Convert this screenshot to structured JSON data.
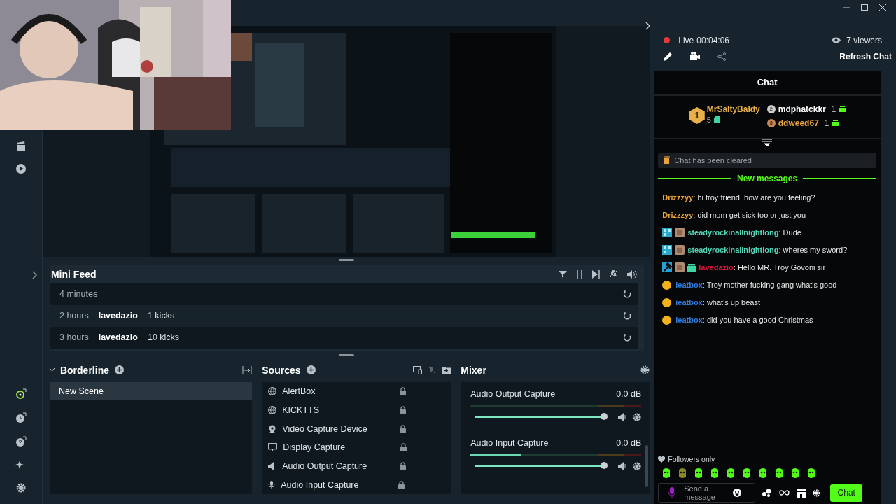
{
  "stream": {
    "live": true,
    "live_label": "Live",
    "timer": "00:04:06",
    "viewers": "7 viewers",
    "refresh": "Refresh Chat"
  },
  "mini_feed": {
    "title": "Mini Feed",
    "rows": [
      {
        "time": "4 minutes"
      },
      {
        "time": "2 hours",
        "user": "lavedazio",
        "amount": "1 kicks"
      },
      {
        "time": "3 hours",
        "user": "lavedazio",
        "amount": "10 kicks"
      }
    ]
  },
  "scenes": {
    "title": "Borderline",
    "items": [
      {
        "name": "New Scene",
        "selected": true
      }
    ]
  },
  "sources": {
    "title": "Sources",
    "items": [
      {
        "name": "AlertBox",
        "kind": "browser"
      },
      {
        "name": "KICKTTS",
        "kind": "browser"
      },
      {
        "name": "Video Capture Device",
        "kind": "camera"
      },
      {
        "name": "Display Capture",
        "kind": "display"
      },
      {
        "name": "Audio Output Capture",
        "kind": "speaker"
      },
      {
        "name": "Audio Input Capture",
        "kind": "mic"
      }
    ]
  },
  "mixer": {
    "title": "Mixer",
    "channels": [
      {
        "name": "Audio Output Capture",
        "reading": "0.0 dB",
        "level": 0.97
      },
      {
        "name": "Audio Input Capture",
        "reading": "0.0 dB",
        "level": 0.97,
        "meter": {
          "level": 0.3
        }
      }
    ]
  },
  "chat": {
    "title": "Chat",
    "gifters": [
      {
        "rank": "1",
        "name": "MrSaltyBaldy",
        "count": "5",
        "color": "#e8b04a"
      },
      {
        "rank": "2",
        "name": "mdphatckkr",
        "count": "1",
        "color": "#ffffff"
      },
      {
        "rank": "3",
        "name": "ddweed67",
        "count": "1",
        "color": "#e8a33a"
      }
    ],
    "cleared": "Chat has been cleared",
    "divider": "New messages",
    "messages": [
      {
        "kind": "plain",
        "user": "Drizzzyy",
        "color": "#e8a33a",
        "text": ": hi troy friend, how are you feeling?"
      },
      {
        "kind": "plain",
        "user": "Drizzzyy",
        "color": "#e8a33a",
        "text": ": did mom get sick too or just you"
      },
      {
        "kind": "og",
        "user": "steadyrockinallnightlong",
        "color": "#52d6b8",
        "text": ": Dude"
      },
      {
        "kind": "og",
        "user": "steadyrockinallnightlong",
        "color": "#52d6b8",
        "text": ": wheres my sword?"
      },
      {
        "kind": "mod",
        "user": "lavedazio",
        "color": "#e0143c",
        "text": ": Hello MR. Troy Govoni sir"
      },
      {
        "kind": "tier",
        "user": "ieatbox",
        "color": "#2f7de1",
        "text": ": Troy mother fucking gang what's good"
      },
      {
        "kind": "tier",
        "user": "ieatbox",
        "color": "#2f7de1",
        "text": ": what's up beast"
      },
      {
        "kind": "tier",
        "user": "ieatbox",
        "color": "#2f7de1",
        "text": ": did you have a good Christmas"
      }
    ],
    "mode": "Followers only",
    "placeholder": "Send a message",
    "send": "Chat"
  }
}
